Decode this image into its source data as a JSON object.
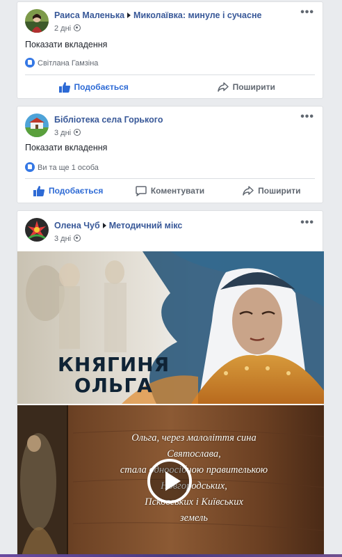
{
  "posts": [
    {
      "author": "Раиса Маленька",
      "group": "Миколаївка: минуле і сучасне",
      "time": "2 дні",
      "attachment_label": "Показати вкладення",
      "reactions": "Світлана Гамзіна",
      "actions": {
        "like": "Подобається",
        "share": "Поширити"
      }
    },
    {
      "author": "Бібліотека села Горького",
      "time": "3 дні",
      "attachment_label": "Показати вкладення",
      "reactions": "Ви та ще 1 особа",
      "actions": {
        "like": "Подобається",
        "comment": "Коментувати",
        "share": "Поширити"
      }
    },
    {
      "author": "Олена Чуб",
      "group": "Методичний мікс",
      "time": "3 дні",
      "image_title": [
        "КНЯГИНЯ",
        "ОЛЬГА"
      ],
      "video_text": [
        "Ольга, через малоліття сина",
        "Святослава,",
        "стала одноосібною правителькою",
        "Новгородських,",
        "Псковських і Київських",
        "земель"
      ]
    }
  ],
  "icons": {
    "menu": "more-options-icon",
    "audience": "globe-icon",
    "like": "thumbs-up-icon",
    "comment": "comment-icon",
    "share": "share-icon",
    "play": "play-icon"
  },
  "colors": {
    "link": "#385898",
    "liked": "#2d6ad5",
    "reaction": "#3578e5",
    "background": "#e9ebee"
  }
}
